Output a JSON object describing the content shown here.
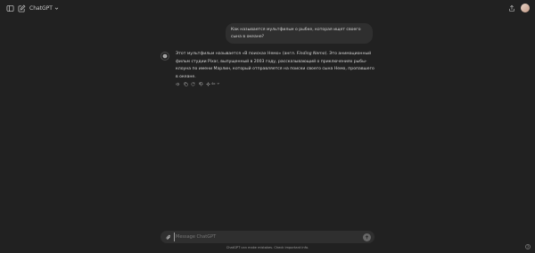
{
  "header": {
    "model_name": "ChatGPT",
    "icons": {
      "sidebar_toggle": "sidebar-icon",
      "new_chat": "edit-icon",
      "model_dropdown": "chevron-down-icon",
      "share": "share-icon"
    }
  },
  "conversation": {
    "user_message": "Как называется мультфильм о рыбке, которая ищет своего сына в океане?",
    "assistant_message": {
      "part1": "Этот мультфильм называется «В поисках Немо» (англ. ",
      "title_en": "Finding Nemo",
      "part2": "). Это анимационный фильм студии Pixar, выпущенный в 2003 году, рассказывающий о приключениях рыбы-клоуна по имени Марлин, который отправляется на поиски своего сына Немо, пропавшего в океане."
    },
    "actions": {
      "model_switch_label": "4o",
      "icons": [
        "speaker-icon",
        "copy-icon",
        "regenerate-icon",
        "thumbs-down-icon",
        "sparkle-icon"
      ]
    }
  },
  "composer": {
    "placeholder": "Message ChatGPT",
    "value": ""
  },
  "footer": {
    "disclaimer": "ChatGPT can make mistakes. Check important info.",
    "help_label": "?"
  },
  "colors": {
    "background": "#212121",
    "bubble": "#2f2f2f",
    "text": "#ececec",
    "muted": "#9b9b9b"
  }
}
